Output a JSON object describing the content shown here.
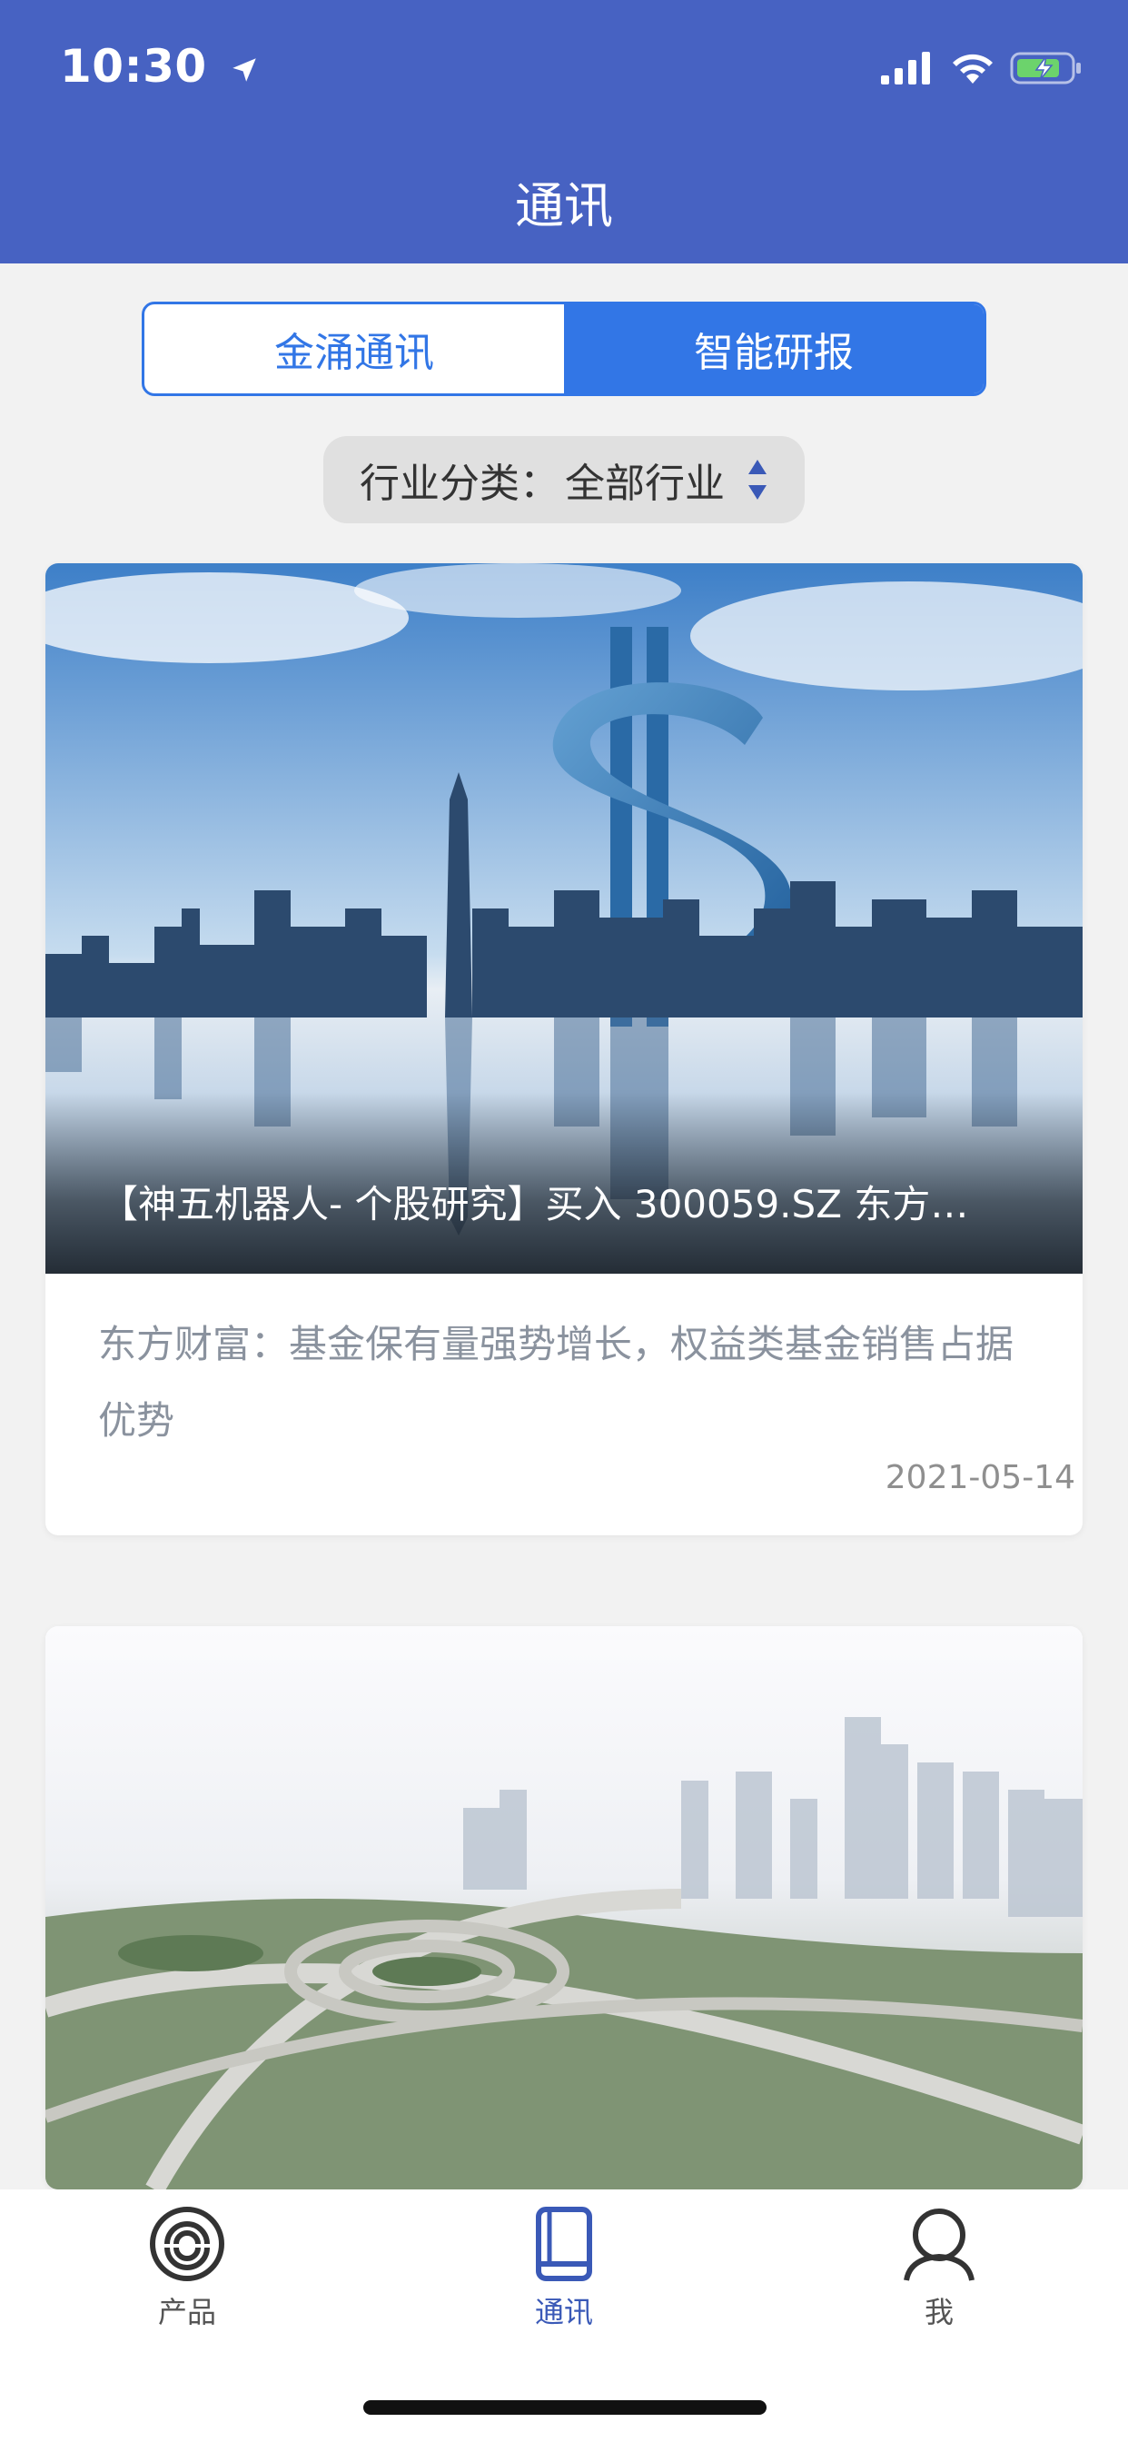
{
  "status_bar": {
    "time": "10:30"
  },
  "header": {
    "title": "通讯"
  },
  "segment": {
    "tabs": [
      {
        "label": "金涌通讯",
        "active": false
      },
      {
        "label": "智能研报",
        "active": true
      }
    ]
  },
  "filter": {
    "label": "行业分类：",
    "value": "全部行业"
  },
  "cards": [
    {
      "title": "【神五机器人- 个股研究】买入 300059.SZ 东方…",
      "description": "东方财富：基金保有量强势增长，权益类基金销售占据优势",
      "date": "2021-05-14",
      "image": "city-skyline-dollar-sign"
    },
    {
      "image": "city-highway-interchange"
    }
  ],
  "tabbar": {
    "items": [
      {
        "label": "产品",
        "icon": "product-icon",
        "active": false
      },
      {
        "label": "通讯",
        "icon": "book-icon",
        "active": true
      },
      {
        "label": "我",
        "icon": "user-icon",
        "active": false
      }
    ]
  },
  "colors": {
    "header_bg": "#4762c2",
    "accent": "#3276e6",
    "tab_active": "#3a59b7"
  }
}
